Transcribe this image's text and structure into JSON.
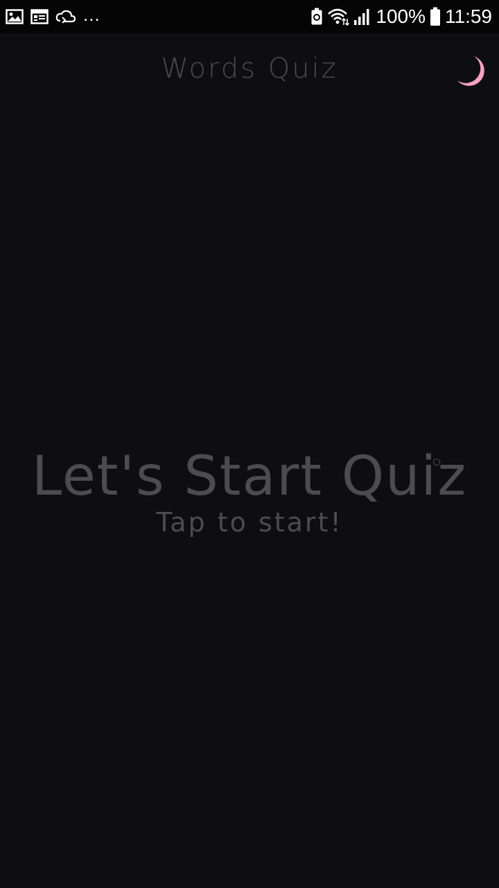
{
  "status_bar": {
    "left_icons": [
      "image-icon",
      "calendar-icon",
      "cloud-sync-icon"
    ],
    "more": "...",
    "battery_percent": "100%",
    "time": "11:59",
    "right_icons": [
      "battery-saver-icon",
      "wifi-icon",
      "signal-icon",
      "battery-icon"
    ]
  },
  "app_bar": {
    "title": "Words Quiz",
    "theme_icon": "moon-icon",
    "theme_icon_color": "#f5a3bf"
  },
  "main": {
    "headline": "Let's Start Quiz",
    "subline": "Tap to start!"
  },
  "colors": {
    "background": "#0e0e10",
    "status_bar_bg": "#050505",
    "text_dim": "#4c4c4f",
    "accent_pink": "#f5a3bf"
  }
}
